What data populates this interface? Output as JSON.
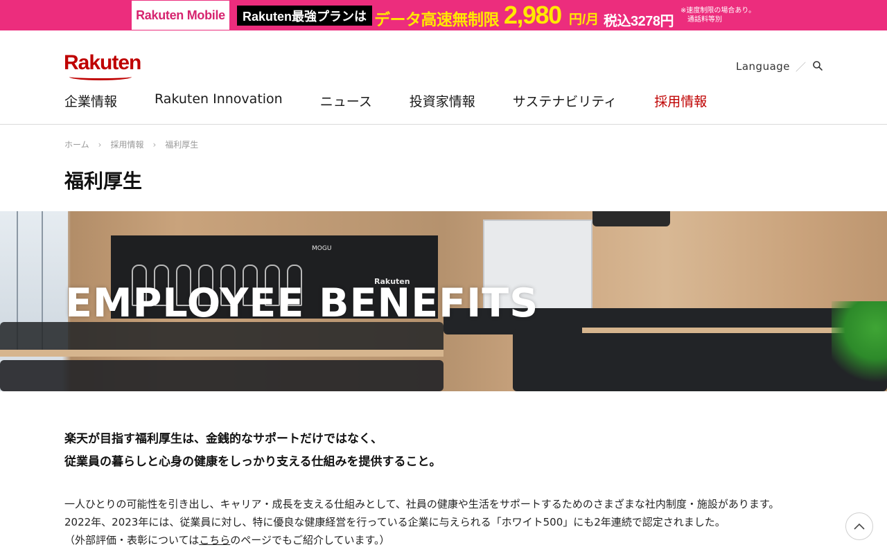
{
  "promo": {
    "brand": "Rakuten Mobile",
    "plan": "Rakuten最強プランは",
    "headline": "データ高速無制限",
    "price": "2,980",
    "unit": "円/月",
    "tax": "税込3278円",
    "note_line1": "※速度制限の場合あり。",
    "note_line2": "通話料等別"
  },
  "header": {
    "logo": "Rakuten",
    "language": "Language",
    "separator": "／",
    "nav": [
      "企業情報",
      "Rakuten Innovation",
      "ニュース",
      "投資家情報",
      "サステナビリティ",
      "採用情報"
    ],
    "active_color": "#bf0000"
  },
  "breadcrumb": {
    "home": "ホーム",
    "careers": "採用情報",
    "current": "福利厚生"
  },
  "page_title": "福利厚生",
  "hero": {
    "title": "EMPLOYEE BENEFITS",
    "chalk_text_1": "Rakuten",
    "chalk_text_2": "MOGU"
  },
  "intro": {
    "lead_line1": "楽天が目指す福利厚生は、金銭的なサポートだけではなく、",
    "lead_line2": "従業員の暮らしと心身の健康をしっかり支える仕組みを提供すること。",
    "body_line1": "一人ひとりの可能性を引き出し、キャリア・成長を支える仕組みとして、社員の健康や生活をサポートするためのさまざまな社内制度・施設があります。",
    "body_line2": "2022年、2023年には、従業員に対し、特に優良な健康経営を行っている企業に与えられる「ホワイト500」にも2年連続で認定されました。",
    "body_line3_pre": "（外部評価・表彰については",
    "body_line3_link": "こちら",
    "body_line3_post": "のページでもご紹介しています。）"
  },
  "colors": {
    "promo_bg": "#ec2d7d",
    "brand_red": "#bf0000",
    "promo_yellow": "#ffe900"
  }
}
